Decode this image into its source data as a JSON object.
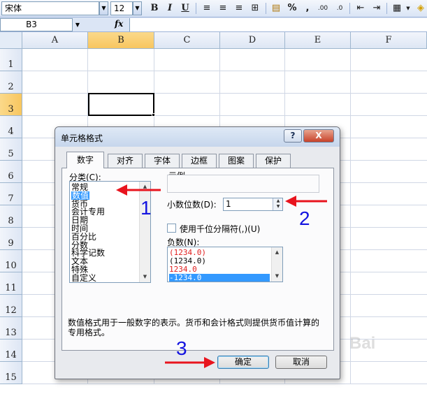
{
  "toolbar": {
    "font_name": "宋体",
    "font_size": "12",
    "bold": "B",
    "italic": "I",
    "underline": "U",
    "percent": "%",
    "comma": ",",
    "dec_inc": ".00",
    "dec_dec": ".0"
  },
  "formula_bar": {
    "cell_ref": "B3",
    "fx": "fx",
    "value": ""
  },
  "columns": [
    "A",
    "B",
    "C",
    "D",
    "E",
    "F"
  ],
  "rows": [
    "1",
    "2",
    "3",
    "4",
    "5",
    "6",
    "7",
    "8",
    "9",
    "10",
    "11",
    "12",
    "13",
    "14",
    "15"
  ],
  "selected_column": "B",
  "selected_row": "3",
  "dialog": {
    "title": "单元格格式",
    "help": "?",
    "close": "X",
    "tabs": [
      "数字",
      "对齐",
      "字体",
      "边框",
      "图案",
      "保护"
    ],
    "active_tab": "数字",
    "category_label": "分类(C):",
    "categories": [
      "常规",
      "数值",
      "货币",
      "会计专用",
      "日期",
      "时间",
      "百分比",
      "分数",
      "科学记数",
      "文本",
      "特殊",
      "自定义"
    ],
    "selected_category": "数值",
    "sample_label": "示例",
    "sample_value": "",
    "decimal_label": "小数位数(D):",
    "decimal_value": "1",
    "thousands_label": "使用千位分隔符(,)(U)",
    "thousands_checked": false,
    "negative_label": "负数(N):",
    "negative_options": [
      "(1234.0)",
      "(1234.0)",
      "1234.0",
      "-1234.0"
    ],
    "negative_selected_index": 3,
    "description": "数值格式用于一般数字的表示。货币和会计格式则提供货币值计算的专用格式。",
    "ok": "确定",
    "cancel": "取消"
  },
  "annotations": {
    "step1": "1",
    "step2": "2",
    "step3": "3"
  },
  "watermark": "Bai",
  "colors": {
    "selected_header": "#f8c65f",
    "annotation_arrow": "#e8141e",
    "annotation_number": "#1414e0",
    "list_selection": "#3399ff",
    "negative_red": "#e01e1e"
  }
}
